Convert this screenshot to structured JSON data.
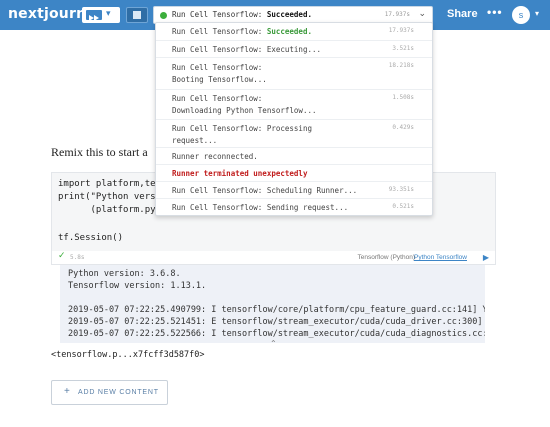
{
  "topbar": {
    "logo": "nextjournal",
    "run_caret": "▾",
    "status_text_prefix": "Run Cell Tensorflow: ",
    "status_text_state": "Succeeded.",
    "status_time": "17.937s",
    "status_chevron": "⌄",
    "share_label": "Share",
    "more_label": "•••",
    "avatar_initial": "s",
    "avatar_caret": "▾",
    "colors": {
      "bar": "#3d85c6",
      "success": "#3cae3c",
      "error": "#c01c1c"
    }
  },
  "dropdown": {
    "items": [
      {
        "label_prefix": "Run Cell Tensorflow: ",
        "label_state": "Succeeded.",
        "time": "17.937s",
        "kind": "success"
      },
      {
        "label": "Run Cell Tensorflow: Executing...",
        "time": "3.521s",
        "kind": "normal"
      },
      {
        "label": "Run Cell Tensorflow:\nBooting Tensorflow...",
        "time": "18.218s",
        "kind": "normal"
      },
      {
        "label": "Run Cell Tensorflow:\nDownloading Python Tensorflow...",
        "time": "1.508s",
        "kind": "normal"
      },
      {
        "label": "Run Cell Tensorflow: Processing\nrequest...",
        "time": "0.429s",
        "kind": "normal"
      },
      {
        "label": "Runner reconnected.",
        "time": "",
        "kind": "normal"
      },
      {
        "label": "Runner terminated unexpectedly",
        "time": "",
        "kind": "error"
      },
      {
        "label": "Run Cell Tensorflow: Scheduling Runner...",
        "time": "93.351s",
        "kind": "normal"
      },
      {
        "label": "Run Cell Tensorflow: Sending request...",
        "time": "0.521s",
        "kind": "normal"
      }
    ]
  },
  "main": {
    "remix_text": "Remix this to start a",
    "code_lines": [
      "import platform,te",
      "print(\"Python vers",
      "      (platform.py",
      "",
      "tf.Session()"
    ],
    "footer": {
      "check": "✓",
      "duration": "5.8s",
      "env_label": "Tensorflow (Python)",
      "env_link": "Python Tensorflow",
      "run_icon": "▶"
    },
    "output_lines": [
      "Python version: 3.6.8.",
      "Tensorflow version: 1.13.1.",
      "",
      "2019-05-07 07:22:25.490799: I tensorflow/core/platform/cpu_feature_guard.cc:141] Yo",
      "2019-05-07 07:22:25.521451: E tensorflow/stream_executor/cuda/cuda_driver.cc:300] f",
      "2019-05-07 07:22:25.522566: I tensorflow/stream_executor/cuda/cuda_diagnostics.cc:1"
    ],
    "collapse_icon": "⌃",
    "result_text": "<tensorflow.p...x7fcff3d587f0>",
    "add_content": {
      "plus": "+",
      "label": "ADD NEW CONTENT"
    }
  }
}
